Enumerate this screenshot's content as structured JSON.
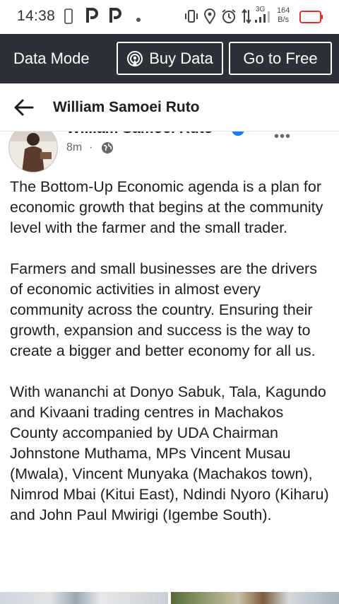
{
  "status_bar": {
    "time": "14:38",
    "network": "3G",
    "speed_value": "164",
    "speed_unit": "B/s"
  },
  "data_bar": {
    "mode_label": "Data Mode",
    "buy_label": "Buy Data",
    "free_label": "Go to Free"
  },
  "header": {
    "title": "William Samoei Ruto"
  },
  "post": {
    "author": "William Samoei Ruto",
    "time": "8m",
    "separator": "·",
    "more": "•••",
    "paragraphs": [
      "The Bottom-Up Economic agenda is a plan for economic growth that begins at the community level with the farmer and the small trader.",
      "Farmers and small businesses are the drivers of economic activities in almost every community across the country. Ensuring their growth, expansion and success is the way to create a bigger and better economy for all us.",
      "With wananchi at Donyo Sabuk, Tala, Kagundo and Kivaani trading centres in Machakos County accompanied by UDA Chairman Johnstone Muthama, MPs Vincent Musau (Mwala), Vincent Munyaka (Machakos town), Nimrod Mbai (Kitui East), Ndindi Nyoro (Kiharu) and John Paul Mwirigi (Igembe South)."
    ]
  },
  "colors": {
    "data_bar_bg": "#2b3137",
    "verified_badge": "#1877f2",
    "battery_outline": "#e0312f"
  }
}
